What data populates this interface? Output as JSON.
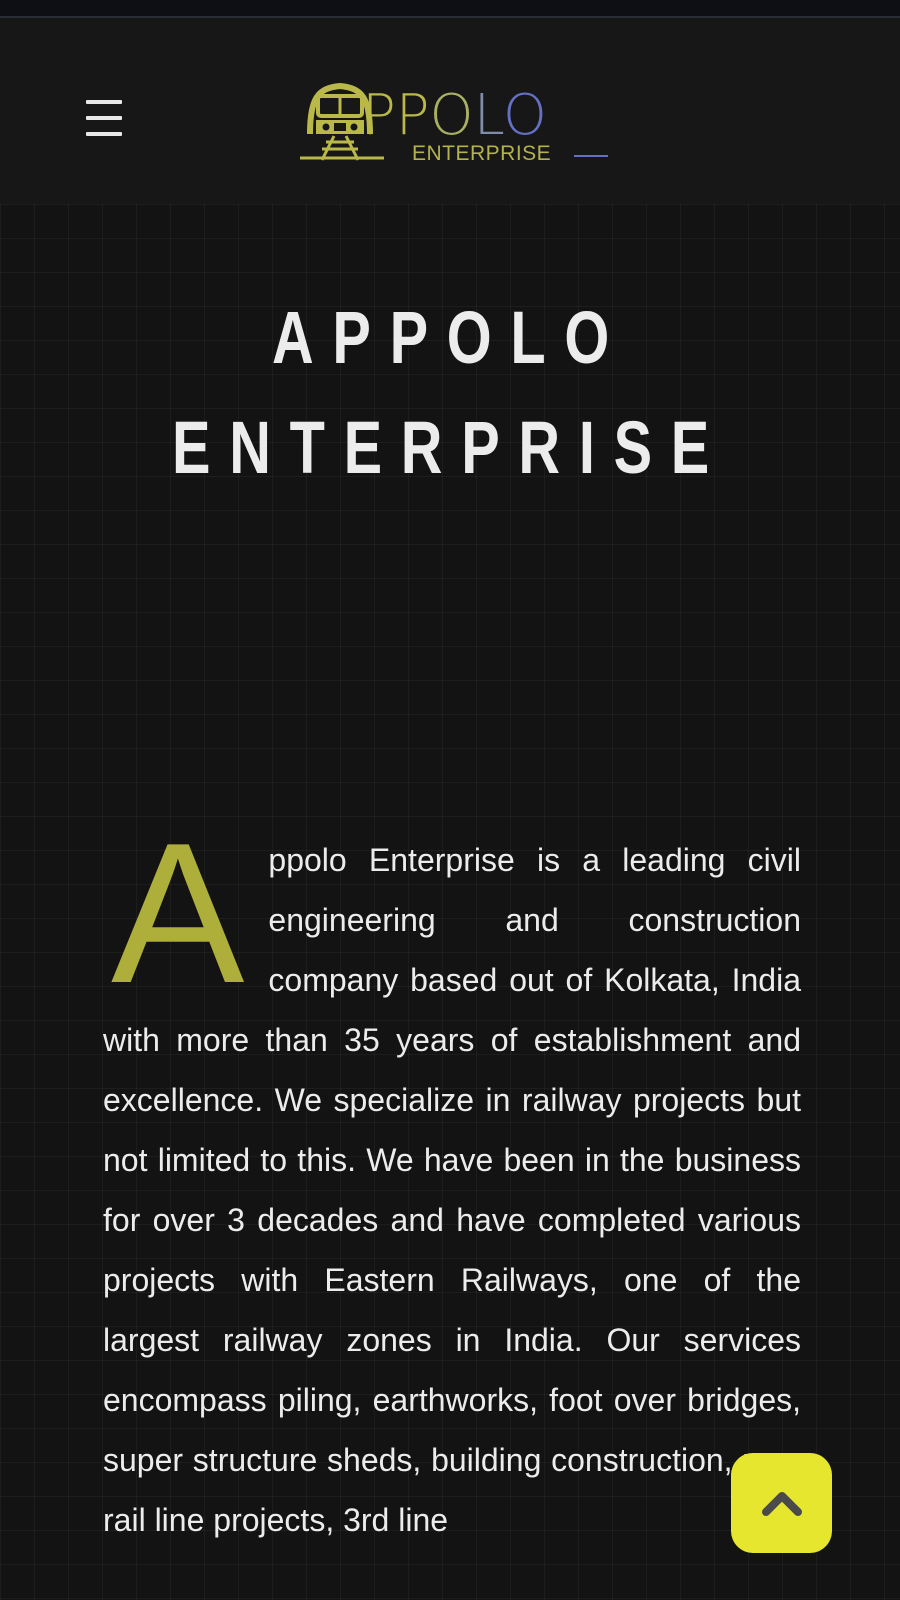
{
  "header": {
    "menu_icon": "hamburger-menu-icon",
    "logo": {
      "word_letters": [
        "PP",
        "O",
        "L",
        "O"
      ],
      "subtitle": "ENTERPRISE",
      "emblem_icon": "train-icon",
      "colors": {
        "gold": "#b9b849",
        "blue": "#6470c4"
      }
    }
  },
  "hero": {
    "title_line1": "APPOLO",
    "title_line2": "ENTERPRISE"
  },
  "about": {
    "drop_cap": "A",
    "text": "ppolo Enterprise is a leading civil engineering and construction company based out of Kolkata, India with more than 35 years of establishment and excellence. We specialize in railway projects but not limited to this. We have been in the business for over 3 decades and have completed various projects with Eastern Railways, one of the largest railway zones in India. Our services encompass piling, earthworks, foot over bridges, super structure sheds, building construction, new rail line projects, 3rd line"
  },
  "scroll_top": {
    "icon": "chevron-up-icon",
    "color": "#e6e62e"
  }
}
